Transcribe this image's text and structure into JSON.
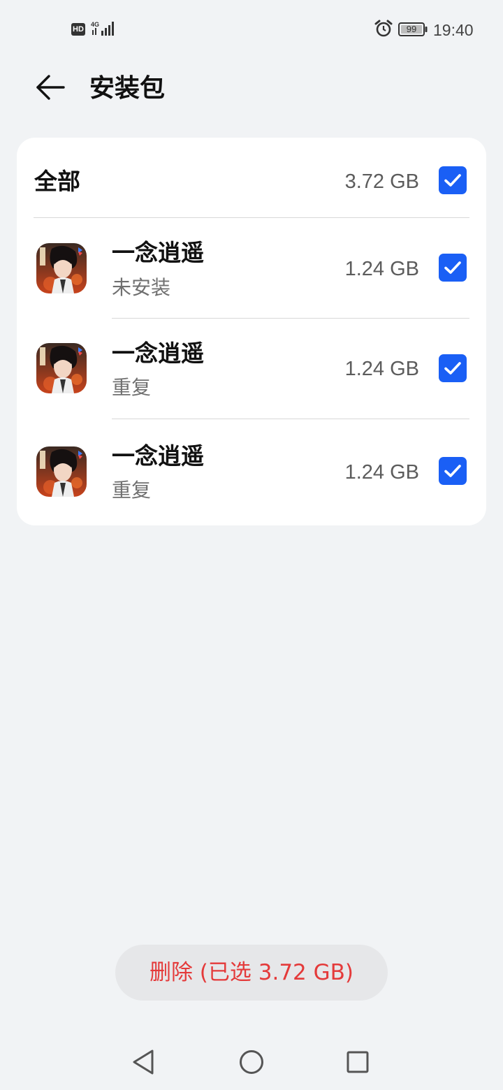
{
  "status_bar": {
    "hd_label": "HD",
    "network_label": "4G",
    "battery": "99",
    "time": "19:40"
  },
  "header": {
    "title": "安装包",
    "back_icon": "arrow-left-icon"
  },
  "summary": {
    "label": "全部",
    "size": "3.72 GB",
    "checked": true
  },
  "packages": [
    {
      "name": "一念逍遥",
      "status": "未安装",
      "size": "1.24 GB",
      "checked": true,
      "icon": "game-app-icon"
    },
    {
      "name": "一念逍遥",
      "status": "重复",
      "size": "1.24 GB",
      "checked": true,
      "icon": "game-app-icon"
    },
    {
      "name": "一念逍遥",
      "status": "重复",
      "size": "1.24 GB",
      "checked": true,
      "icon": "game-app-icon"
    }
  ],
  "footer": {
    "delete_label": "删除 (已选 3.72 GB)"
  },
  "nav": {
    "back_icon": "triangle-back-icon",
    "home_icon": "circle-home-icon",
    "recents_icon": "square-recents-icon"
  },
  "colors": {
    "accent": "#1a5ff5",
    "danger": "#e43a3a",
    "background": "#f1f3f5"
  }
}
